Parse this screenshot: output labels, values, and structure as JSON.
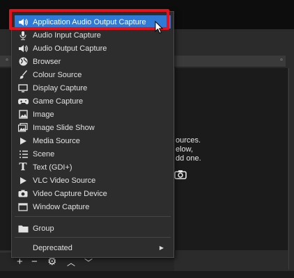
{
  "menu": {
    "items": [
      {
        "label": "Application Audio Output Capture",
        "icon": "speaker-icon",
        "highlighted": true
      },
      {
        "label": "Audio Input Capture",
        "icon": "microphone-icon"
      },
      {
        "label": "Audio Output Capture",
        "icon": "speaker-icon"
      },
      {
        "label": "Browser",
        "icon": "globe-icon"
      },
      {
        "label": "Colour Source",
        "icon": "paintbrush-icon"
      },
      {
        "label": "Display Capture",
        "icon": "monitor-icon"
      },
      {
        "label": "Game Capture",
        "icon": "gamepad-icon"
      },
      {
        "label": "Image",
        "icon": "image-icon"
      },
      {
        "label": "Image Slide Show",
        "icon": "slideshow-icon"
      },
      {
        "label": "Media Source",
        "icon": "play-icon"
      },
      {
        "label": "Scene",
        "icon": "list-icon"
      },
      {
        "label": "Text (GDI+)",
        "icon": "text-icon"
      },
      {
        "label": "VLC Video Source",
        "icon": "play-icon"
      },
      {
        "label": "Video Capture Device",
        "icon": "camera-icon"
      },
      {
        "label": "Window Capture",
        "icon": "window-icon"
      }
    ],
    "group_label": "Group",
    "deprecated_label": "Deprecated"
  },
  "background": {
    "sources_hint": "ources.\nelow,\ndd one."
  },
  "colors": {
    "highlight": "#2f7ad6",
    "annotation_border": "#e8101a"
  }
}
